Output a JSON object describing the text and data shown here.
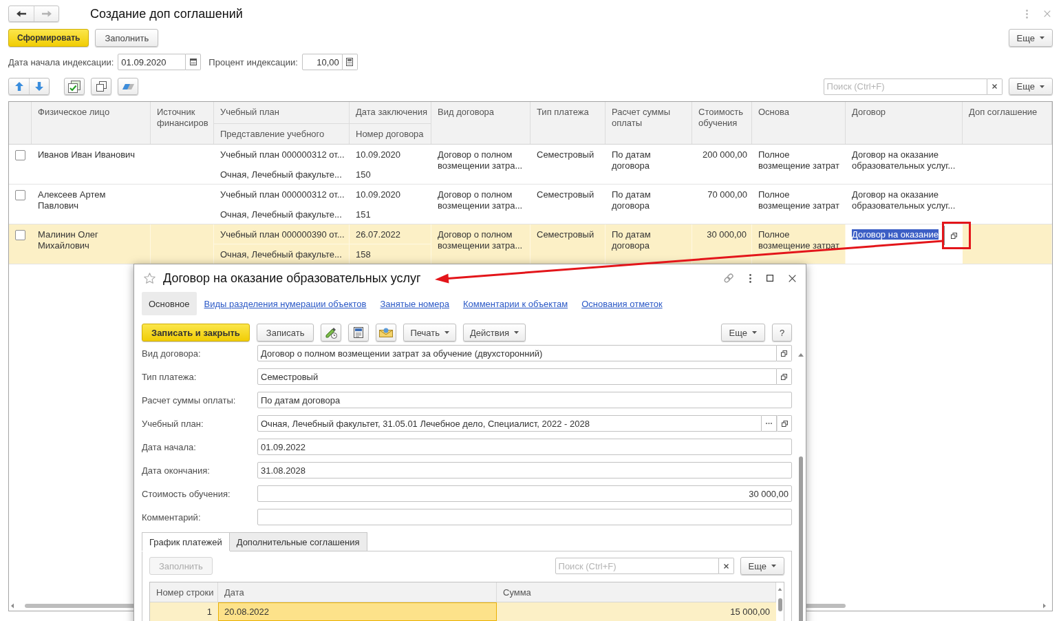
{
  "window": {
    "title": "Создание доп соглашений"
  },
  "navigation": [
    {
      "kind": "back",
      "disabled": false
    },
    {
      "kind": "forward",
      "disabled": true
    }
  ],
  "command_bar": {
    "buttons": [
      {
        "label": "Сформировать",
        "kind": "primary"
      },
      {
        "label": "Заполнить",
        "kind": "default"
      }
    ],
    "more": "Еще"
  },
  "parameters": [
    {
      "label": "Дата начала индексации:",
      "value": "01.09.2020",
      "kind": "date"
    },
    {
      "label": "Процент индексации:",
      "value": "10,00",
      "kind": "number"
    }
  ],
  "table_toolbar": {
    "search": {
      "placeholder": "Поиск (Ctrl+F)"
    },
    "more": "Еще"
  },
  "table": {
    "columns": [
      {
        "title": "Физическое лицо"
      },
      {
        "title": "Источник финансиров"
      },
      {
        "title": "Учебный план",
        "subtitle": "Представление учебного"
      },
      {
        "title": "Дата заключения",
        "subtitle": "Номер договора"
      },
      {
        "title": "Вид договора"
      },
      {
        "title": "Тип платежа"
      },
      {
        "title": "Расчет суммы оплаты"
      },
      {
        "title": "Стоимость обучения"
      },
      {
        "title": "Основа"
      },
      {
        "title": "Договор"
      },
      {
        "title": "Доп соглашение"
      }
    ],
    "rows": [
      {
        "checked": false,
        "selected": false,
        "editing": false,
        "person": "Иванов Иван Иванович",
        "study_plan": "Учебный план 000000312 от...",
        "study_plan_view": "Очная, Лечебный факульте...",
        "date": "10.09.2020",
        "number": "150",
        "contract_type": "Договор о полном возмещении затра...",
        "payment_type": "Семестровый",
        "calculation": "По датам договора",
        "cost": "200 000,00",
        "basis": "Полное возмещение затрат",
        "contract": "Договор на оказание образовательных услуг..."
      },
      {
        "checked": false,
        "selected": false,
        "editing": false,
        "person": "Алексеев Артем Павлович",
        "study_plan": "Учебный план 000000312 от...",
        "study_plan_view": "Очная, Лечебный факульте...",
        "date": "10.09.2020",
        "number": "151",
        "contract_type": "Договор о полном возмещении затра...",
        "payment_type": "Семестровый",
        "calculation": "По датам договора",
        "cost": "70 000,00",
        "basis": "Полное возмещение затрат",
        "contract": "Договор на оказание образовательных услуг..."
      },
      {
        "checked": false,
        "selected": true,
        "editing": true,
        "person": "Малинин Олег Михайлович",
        "study_plan": "Учебный план 000000390 от...",
        "study_plan_view": "Очная, Лечебный факульте...",
        "date": "26.07.2022",
        "number": "158",
        "contract_type": "Договор о полном возмещении затра...",
        "payment_type": "Семестровый",
        "calculation": "По датам договора",
        "cost": "30 000,00",
        "basis": "Полное возмещение затрат",
        "contract": "Договор на оказание"
      }
    ]
  },
  "dialog": {
    "title": "Договор на оказание образовательных услуг",
    "favorite": false,
    "sections": [
      {
        "label": "Основное",
        "selected": true
      },
      {
        "label": "Виды разделения нумерации объектов",
        "selected": false
      },
      {
        "label": "Занятые номера",
        "selected": false
      },
      {
        "label": "Комментарии к объектам",
        "selected": false
      },
      {
        "label": "Основания отметок",
        "selected": false
      }
    ],
    "toolbar": {
      "buttons": [
        {
          "label": "Записать и закрыть",
          "kind": "primary"
        },
        {
          "label": "Записать",
          "kind": "default"
        }
      ],
      "menus": [
        "Печать",
        "Действия"
      ],
      "more": "Еще",
      "help": "?"
    },
    "fields": [
      {
        "label": "Вид договора:",
        "value": "Договор о полном возмещении затрат за обучение (двухсторонний)",
        "kind": "text",
        "select_button": false,
        "open_button": true
      },
      {
        "label": "Тип платежа:",
        "value": "Семестровый",
        "kind": "text",
        "select_button": false,
        "open_button": true
      },
      {
        "label": "Расчет суммы оплаты:",
        "value": "По датам договора",
        "kind": "text",
        "select_button": false,
        "open_button": false
      },
      {
        "label": "Учебный план:",
        "value": "Очная, Лечебный факультет, 31.05.01 Лечебное дело, Специалист, 2022 - 2028",
        "kind": "text",
        "select_button": true,
        "open_button": true
      },
      {
        "label": "Дата начала:",
        "value": "01.09.2022",
        "kind": "text",
        "select_button": false,
        "open_button": false
      },
      {
        "label": "Дата окончания:",
        "value": "31.08.2028",
        "kind": "text",
        "select_button": false,
        "open_button": false
      },
      {
        "label": "Стоимость обучения:",
        "value": "30 000,00",
        "kind": "number",
        "select_button": false,
        "open_button": false
      },
      {
        "label": "Комментарий:",
        "kind": "text",
        "select_button": false,
        "open_button": false
      }
    ],
    "tabs": [
      {
        "label": "График платежей",
        "selected": true
      },
      {
        "label": "Дополнительные соглашения",
        "selected": false
      }
    ],
    "payments": {
      "fill_button": {
        "label": "Заполнить",
        "disabled": true
      },
      "search": {
        "placeholder": "Поиск (Ctrl+F)"
      },
      "more": "Еще",
      "columns": [
        {
          "title": "Номер строки",
          "current": false
        },
        {
          "title": "Дата",
          "current": true
        },
        {
          "title": "Сумма",
          "current": false
        }
      ],
      "rows": [
        {
          "number": "1",
          "date": "20.08.2022",
          "amount": "15 000,00",
          "selected": true
        }
      ]
    }
  }
}
